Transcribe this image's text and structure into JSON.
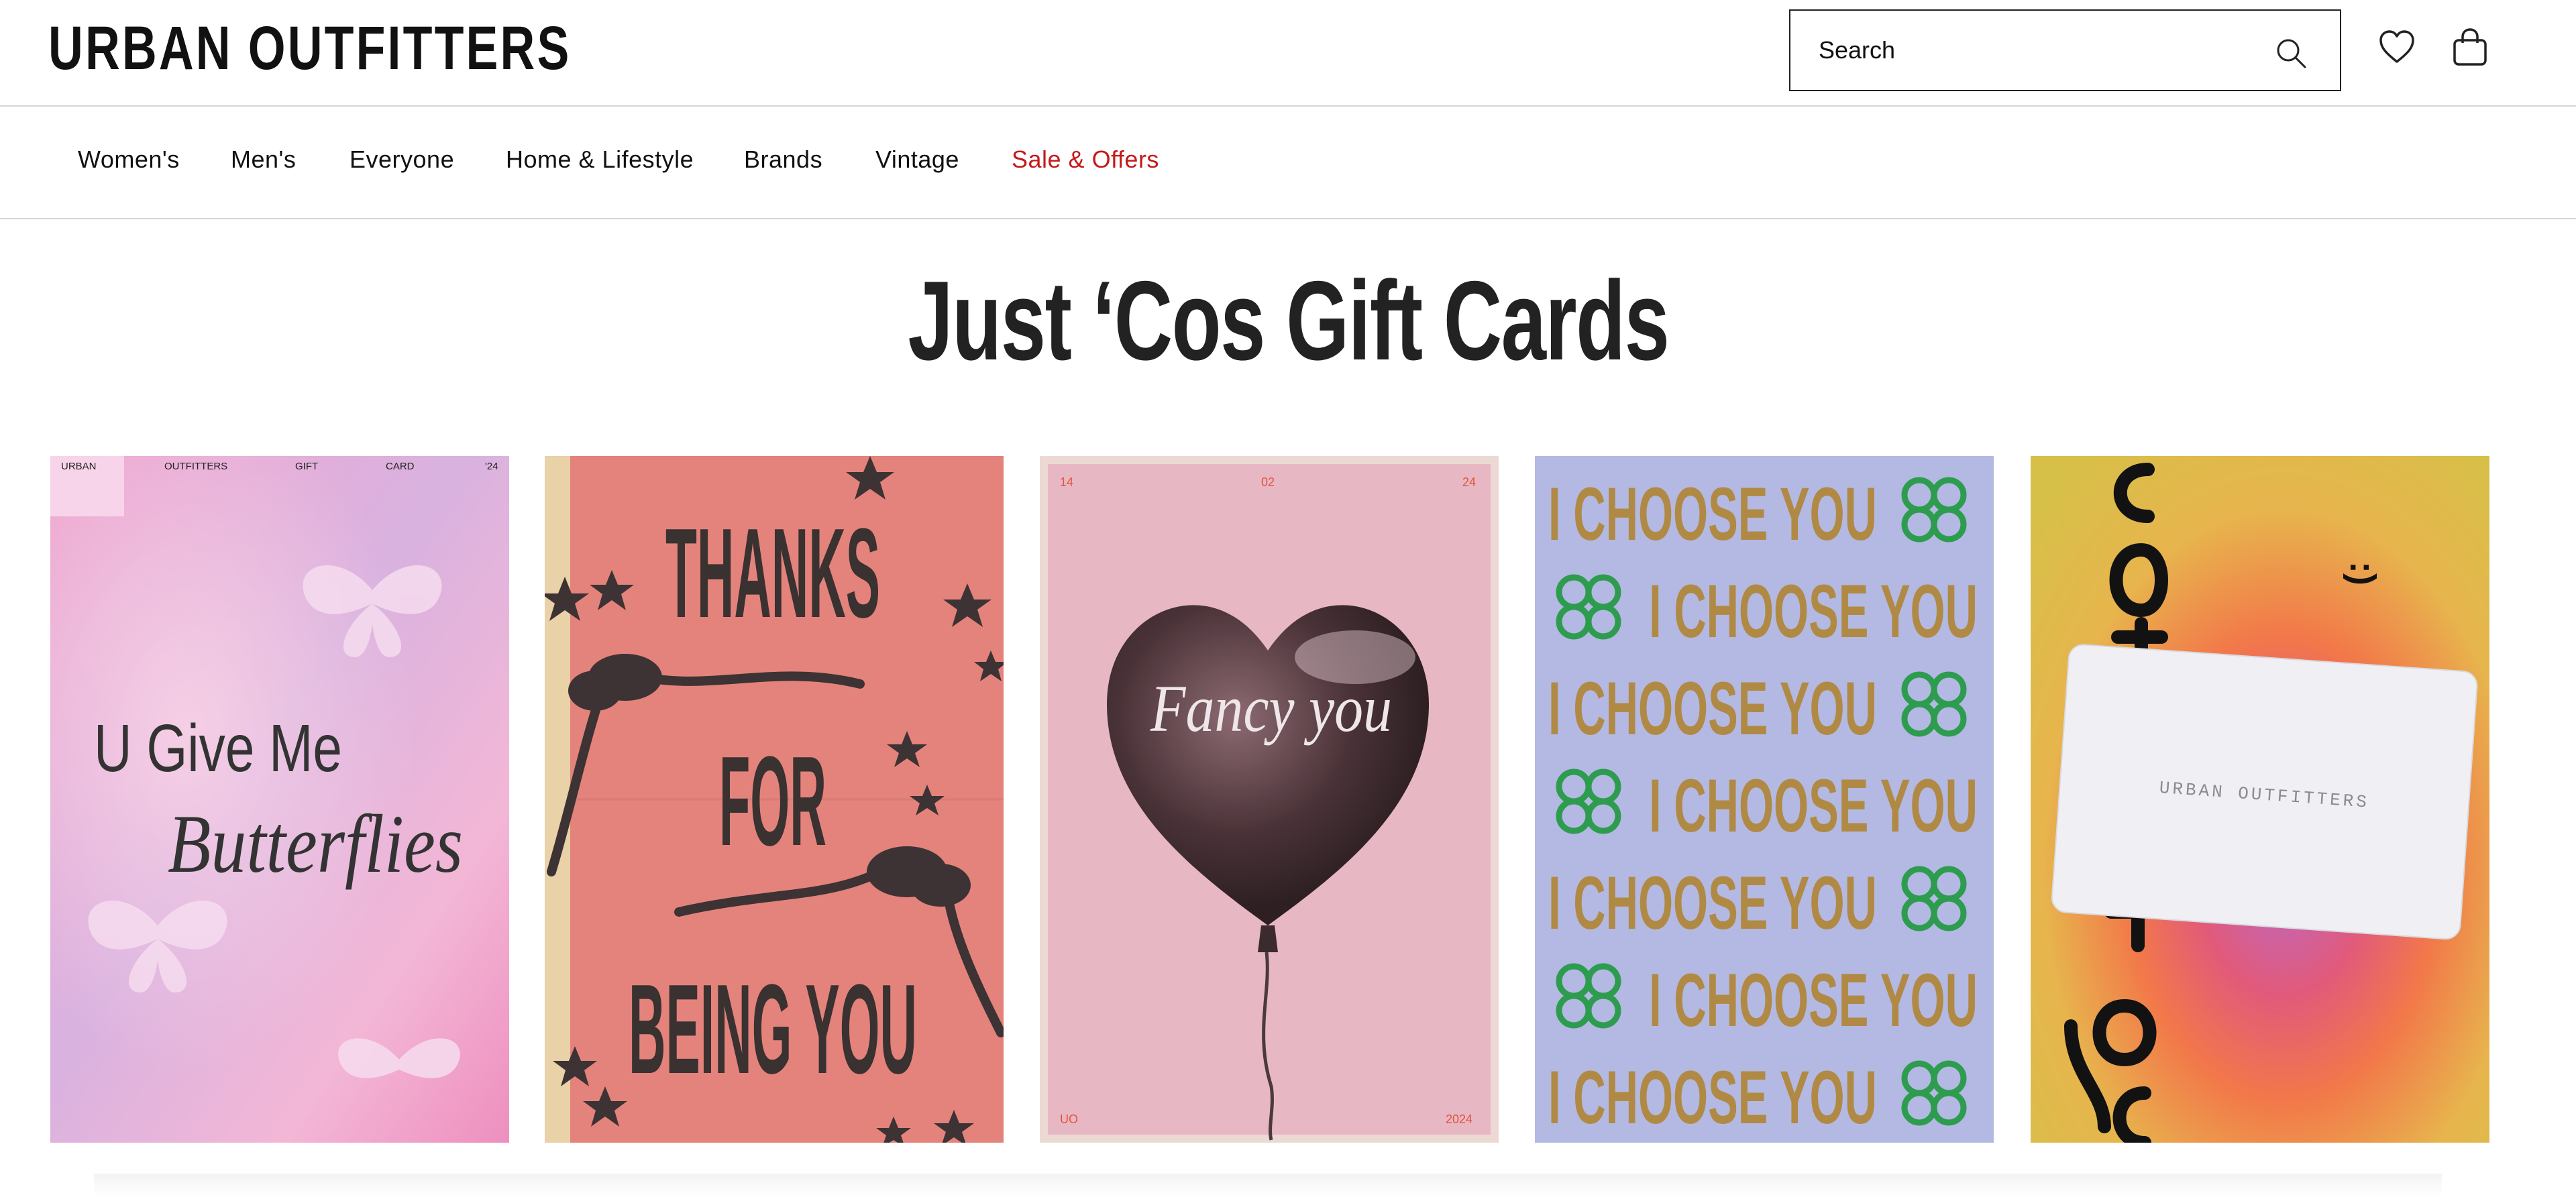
{
  "header": {
    "logo": "URBAN OUTFITTERS",
    "search_placeholder": "Search",
    "icons": {
      "search": "search-icon",
      "wishlist": "heart-icon",
      "bag": "bag-icon"
    }
  },
  "nav": {
    "items": [
      {
        "label": "Women's"
      },
      {
        "label": "Men's"
      },
      {
        "label": "Everyone"
      },
      {
        "label": "Home & Lifestyle"
      },
      {
        "label": "Brands"
      },
      {
        "label": "Vintage"
      },
      {
        "label": "Sale & Offers",
        "color": "#c41a1a"
      }
    ]
  },
  "page": {
    "title": "Just ‘Cos Gift Cards"
  },
  "cards": [
    {
      "name": "butterflies-card",
      "line1": "U Give Me",
      "line2": "Butterflies",
      "top_labels": [
        "URBAN",
        "OUTFITTERS",
        "GIFT",
        "CARD",
        "'24"
      ]
    },
    {
      "name": "thanks-card",
      "line1": "THANKS",
      "line2": "FOR",
      "line3": "BEING YOU"
    },
    {
      "name": "fancy-you-card",
      "text": "Fancy you",
      "corners": [
        "14",
        "02",
        "24",
        "UO",
        "2024"
      ]
    },
    {
      "name": "i-choose-you-card",
      "text": "I CHOOSE YOU"
    },
    {
      "name": "urban-outfitters-card",
      "card_text": "URBAN OUTFITTERS",
      "smiley": ":)"
    }
  ],
  "colors": {
    "sale": "#c41a1a",
    "title": "#222222"
  }
}
